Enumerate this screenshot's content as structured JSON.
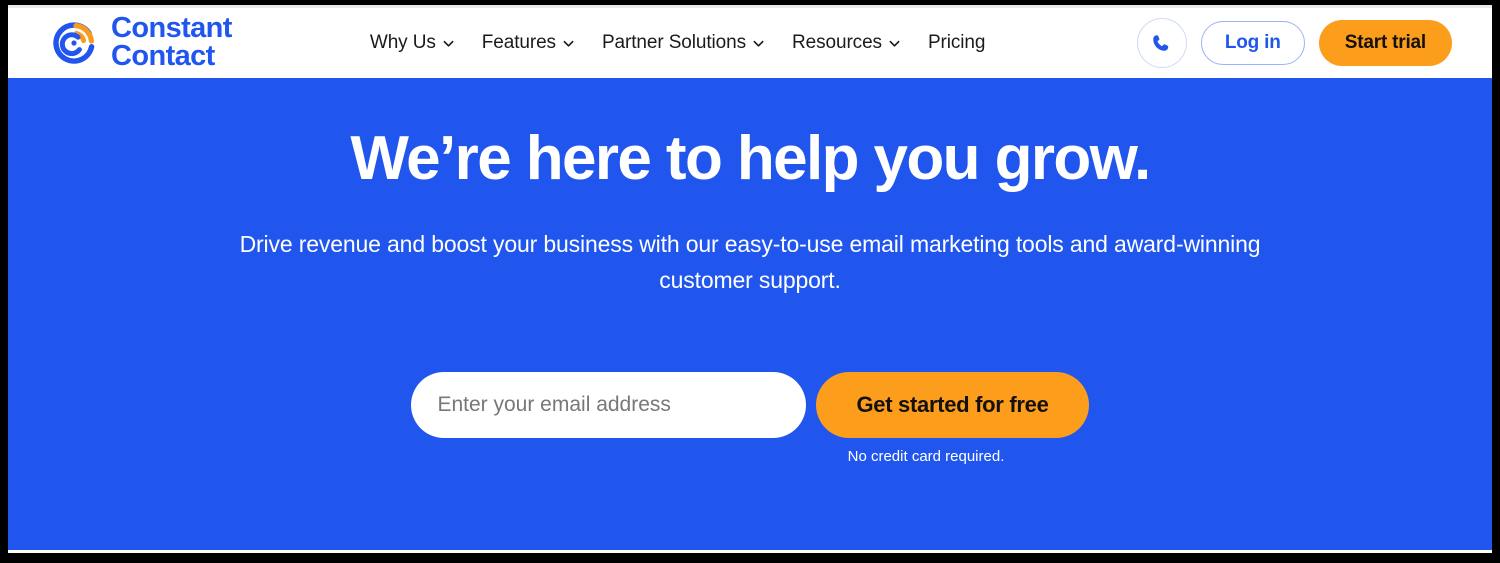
{
  "brand": {
    "name_line1": "Constant",
    "name_line2": "Contact",
    "logo_icon": "constant-contact-swirl-logo",
    "blue": "#2156ee",
    "orange": "#fc9d1c"
  },
  "header": {
    "nav": [
      {
        "label": "Why Us",
        "has_dropdown": true,
        "icon": "chevron-down-icon"
      },
      {
        "label": "Features",
        "has_dropdown": true,
        "icon": "chevron-down-icon"
      },
      {
        "label": "Partner Solutions",
        "has_dropdown": true,
        "icon": "chevron-down-icon"
      },
      {
        "label": "Resources",
        "has_dropdown": true,
        "icon": "chevron-down-icon"
      },
      {
        "label": "Pricing",
        "has_dropdown": false,
        "icon": ""
      }
    ],
    "phone_icon": "phone-icon",
    "login_label": "Log in",
    "trial_label": "Start trial"
  },
  "hero": {
    "title": "We’re here to help you grow.",
    "subtitle": "Drive revenue and boost your business with our easy-to-use email marketing tools and award-winning customer support.",
    "background_color": "#2156ee",
    "email_placeholder": "Enter your email address",
    "email_value": "",
    "cta_label": "Get started for free",
    "disclaimer": "No credit card required."
  }
}
